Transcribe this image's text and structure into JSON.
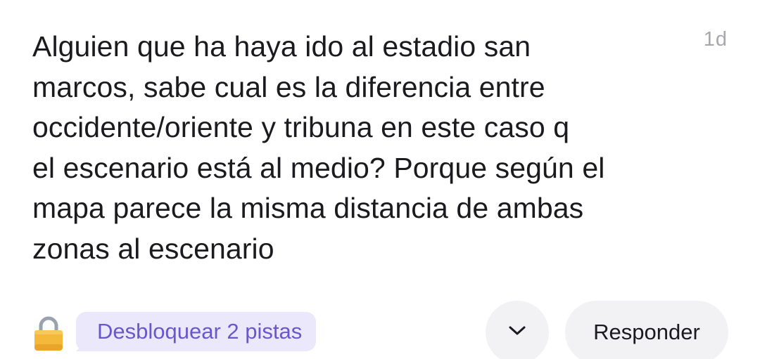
{
  "post": {
    "body": "Alguien que ha haya ido al estadio san\nmarcos, sabe cual es la diferencia entre\noccidente/oriente y tribuna en este caso q\nel escenario está al medio? Porque según el\nmapa parece la misma distancia de ambas\nzonas al escenario",
    "timestamp": "1d"
  },
  "actions": {
    "lock_icon": "lock-icon",
    "hints_label": "Desbloquear 2 pistas",
    "expand_icon": "chevron-down-icon",
    "reply_label": "Responder"
  },
  "colors": {
    "text": "#1b1b1f",
    "timestamp": "#a7a7ad",
    "hints_chip_bg": "#ece8fb",
    "hints_text": "#6a57c9",
    "button_bg": "#f2f2f5",
    "lock_body": "#f4b93a"
  }
}
